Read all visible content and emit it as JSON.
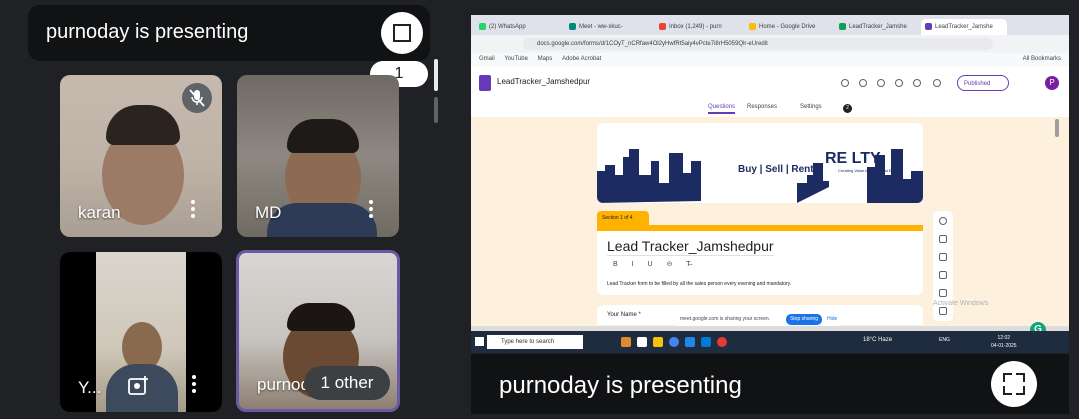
{
  "left_header": {
    "title": "purnoday is presenting",
    "fullscreen_icon": "fullscreen-icon"
  },
  "page_indicator": "1",
  "tiles": [
    {
      "name": "karan",
      "muted": true
    },
    {
      "name": "MD"
    },
    {
      "name": "Y..."
    },
    {
      "name": "purnoday",
      "name_visible": "purnod",
      "other_label": "1 other"
    }
  ],
  "screen": {
    "tabs": [
      {
        "label": "(2) WhatsApp",
        "color": "#25d366"
      },
      {
        "label": "Meet - ww-xkuc-",
        "color": "#00897b"
      },
      {
        "label": "Inbox (1,249) - purn",
        "color": "#ea4335"
      },
      {
        "label": "Home - Google Drive",
        "color": "#fbbc04"
      },
      {
        "label": "LeadTracker_Jamshe",
        "color": "#0f9d58"
      },
      {
        "label": "LeadTracker_Jamshe",
        "color": "#673ab7"
      }
    ],
    "url": "docs.google.com/forms/d/1COyT_nCRfaw4Ol2yHwfRt5aiy4vPcte7i8rH5059Qlr-eUredit",
    "bookmarks": [
      "Gmail",
      "YouTube",
      "Maps",
      "Adobe Acrobat"
    ],
    "all_bookmarks": "All Bookmarks",
    "doc_title": "LeadTracker_Jamshedpur",
    "publish_label": "Published",
    "avatar_letter": "P",
    "form_tabs": [
      "Questions",
      "Responses",
      "Settings"
    ],
    "responses_count": "2",
    "banner_tagline": "Buy | Sell | Rent",
    "banner_logo": "RE  LTY",
    "banner_sub": "Creating Value beyond Real Estate",
    "section_label": "Section 1 of 4",
    "form_title": "Lead Tracker_Jamshedpur",
    "format_tools": "B I U ⊝ T̶",
    "form_description": "Lead Tracker form to be filled by all the sales person every evening and mandatory.",
    "question_label": "Your Name *",
    "share_note": "meet.google.com is sharing your screen.",
    "stop_sharing": "Stop sharing",
    "hide": "Hide",
    "activate": "Activate Windows",
    "taskbar_search": "Type here to search",
    "weather": "18°C  Haze",
    "lang": "ENG",
    "clock_time": "12:02",
    "clock_date": "04-01-2025"
  },
  "bottom_banner": {
    "title": "purnoday is presenting",
    "fullscreen_icon": "fullscreen-icon"
  },
  "colors": {
    "background": "#202124",
    "accent": "#673ab7",
    "form_yellow": "#ffb300"
  }
}
